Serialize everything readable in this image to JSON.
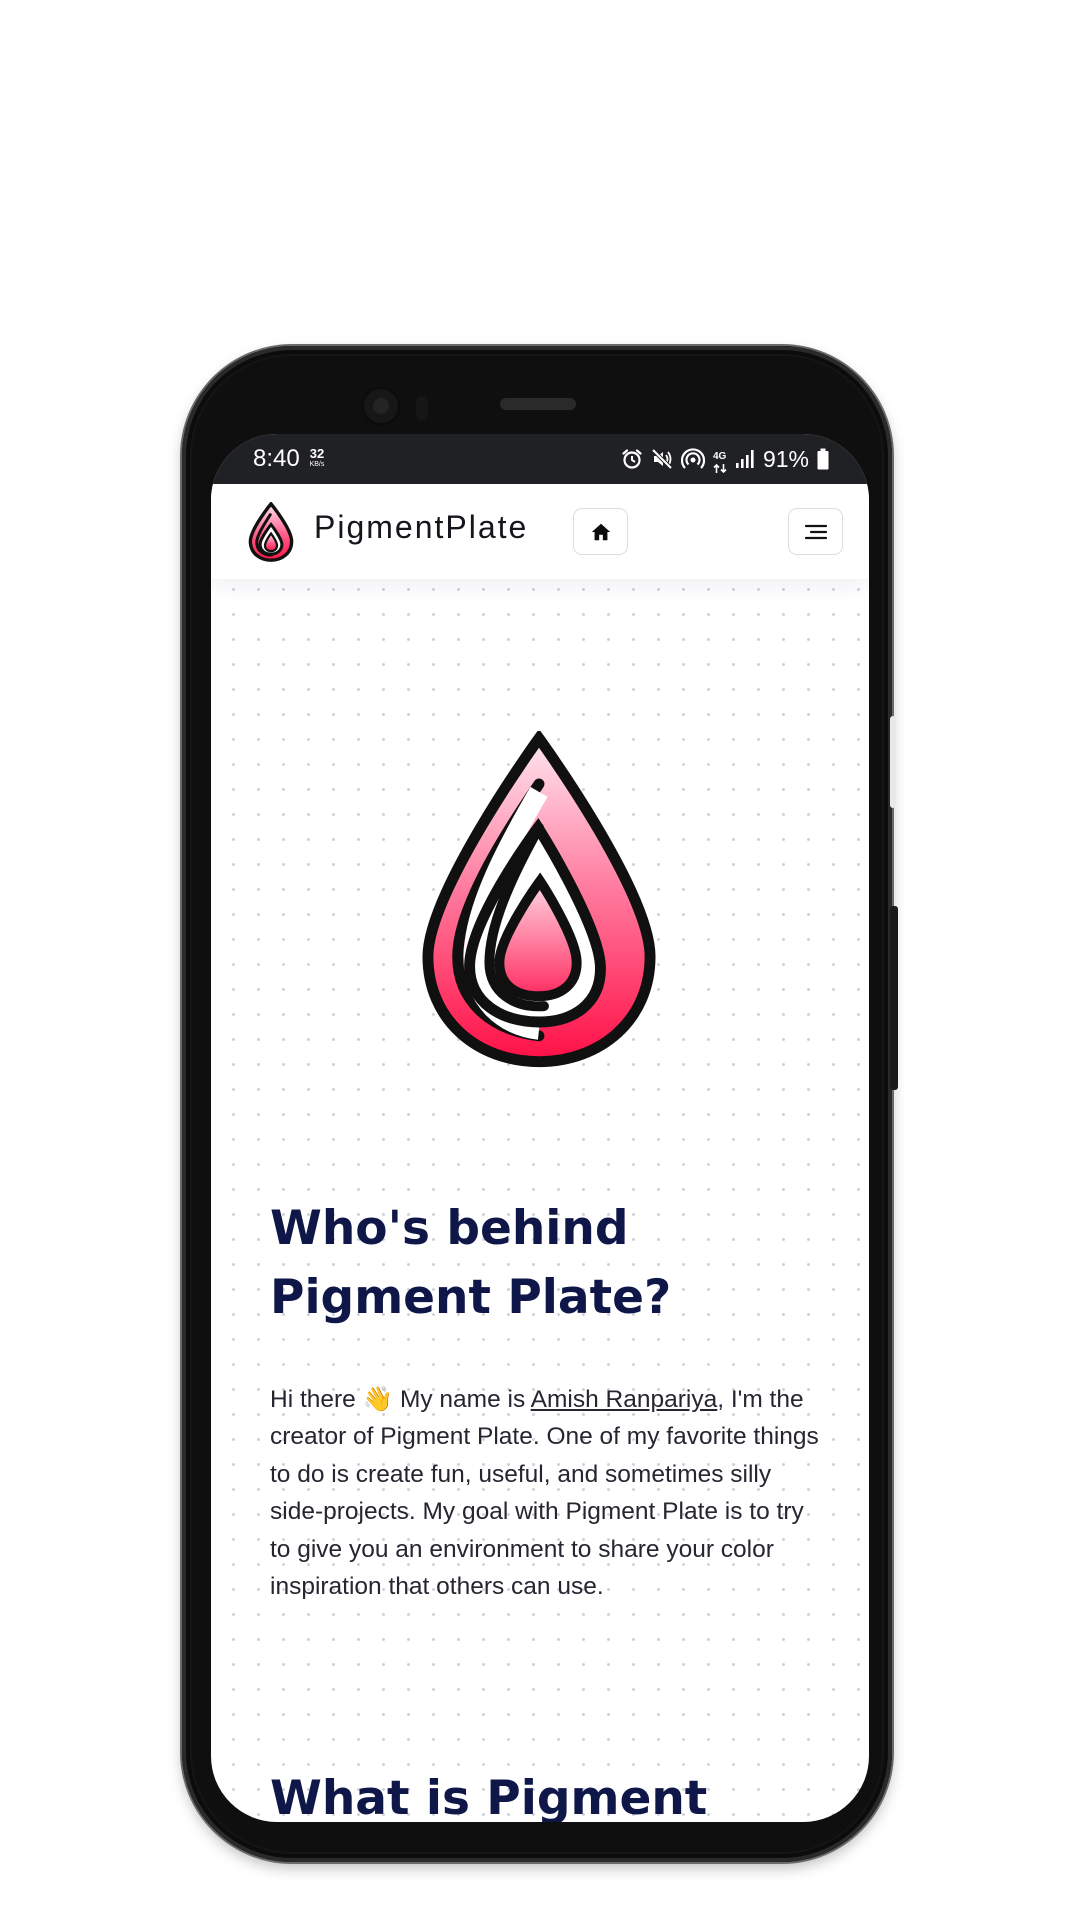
{
  "status_bar": {
    "time": "8:40",
    "network_speed_value": "32",
    "network_speed_unit": "KB/s",
    "network_type": "4G",
    "battery": "91%",
    "icons": [
      "alarm-icon",
      "mute-icon",
      "hotspot-icon",
      "data-arrows-icon",
      "signal-icon",
      "battery-icon"
    ]
  },
  "header": {
    "brand": "PigmentPlate",
    "home_icon": "home-icon",
    "menu_icon": "menu-icon"
  },
  "about": {
    "title": "Who's behind Pigment Plate?",
    "intro_before": "Hi there",
    "wave_emoji": "👋",
    "intro_mid": "My name is",
    "author_link": "Amish Ranpariya",
    "intro_after": ", I'm the creator of Pigment Plate. One of my favorite things to do is create fun, useful, and sometimes silly side-projects. My goal with Pigment Plate is to try to give you an environment to share your color inspiration that others can use."
  },
  "next_section": {
    "title": "What is Pigment"
  },
  "colors": {
    "title": "#0e1748",
    "body_text": "#262631",
    "accent_pink": "#ff1a55",
    "status_bar": "#202124"
  }
}
